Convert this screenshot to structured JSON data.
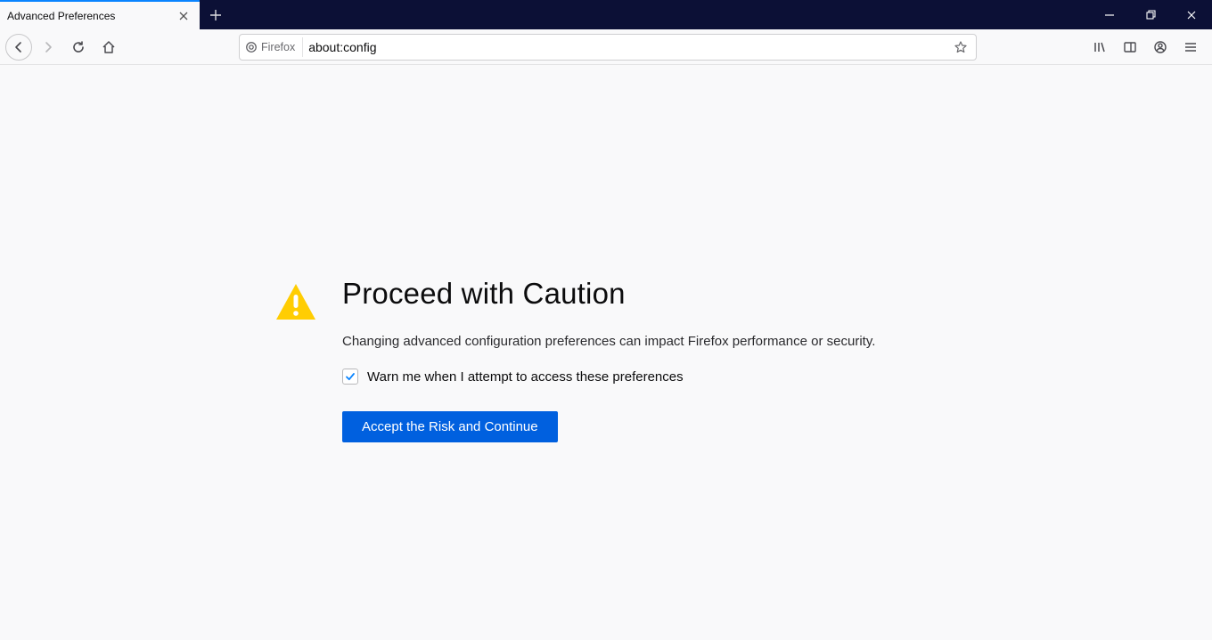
{
  "tab": {
    "title": "Advanced Preferences"
  },
  "urlbar": {
    "identity_label": "Firefox",
    "url": "about:config"
  },
  "warning": {
    "title": "Proceed with Caution",
    "description": "Changing advanced configuration preferences can impact Firefox performance or security.",
    "checkbox_label": "Warn me when I attempt to access these preferences",
    "checkbox_checked": true,
    "accept_button": "Accept the Risk and Continue"
  }
}
